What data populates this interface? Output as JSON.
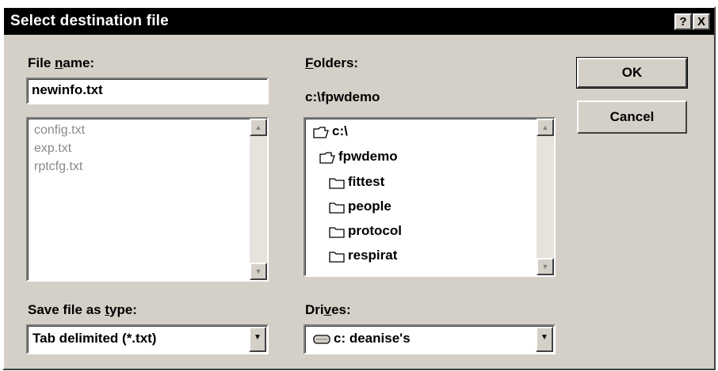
{
  "window": {
    "title": "Select destination file",
    "help_button": "?",
    "close_button": "X"
  },
  "file_name": {
    "label_pre": "File ",
    "label_accel": "n",
    "label_post": "ame:",
    "value": "newinfo.txt",
    "files": [
      "config.txt",
      "exp.txt",
      "rptcfg.txt"
    ]
  },
  "folders": {
    "label_accel": "F",
    "label_post": "olders:",
    "current_path": "c:\\fpwdemo",
    "tree": [
      {
        "name": "c:\\",
        "icon": "open-folder-icon"
      },
      {
        "name": "fpwdemo",
        "icon": "open-folder-icon"
      },
      {
        "name": "fittest",
        "icon": "folder-icon"
      },
      {
        "name": "people",
        "icon": "folder-icon"
      },
      {
        "name": "protocol",
        "icon": "folder-icon"
      },
      {
        "name": "respirat",
        "icon": "folder-icon"
      }
    ]
  },
  "buttons": {
    "ok": "OK",
    "cancel": "Cancel"
  },
  "save_type": {
    "label_pre": "Save file as ",
    "label_accel": "t",
    "label_post": "ype:",
    "selected": "Tab delimited (*.txt)"
  },
  "drives": {
    "label_pre": "Dri",
    "label_accel": "v",
    "label_post": "es:",
    "selected": "c: deanise's",
    "icon": "drive-icon"
  },
  "colors": {
    "dialog_bg": "#d4d0c8",
    "titlebar_bg": "#000000",
    "title_text": "#ffffff",
    "disabled_text": "#8a8a8a"
  }
}
